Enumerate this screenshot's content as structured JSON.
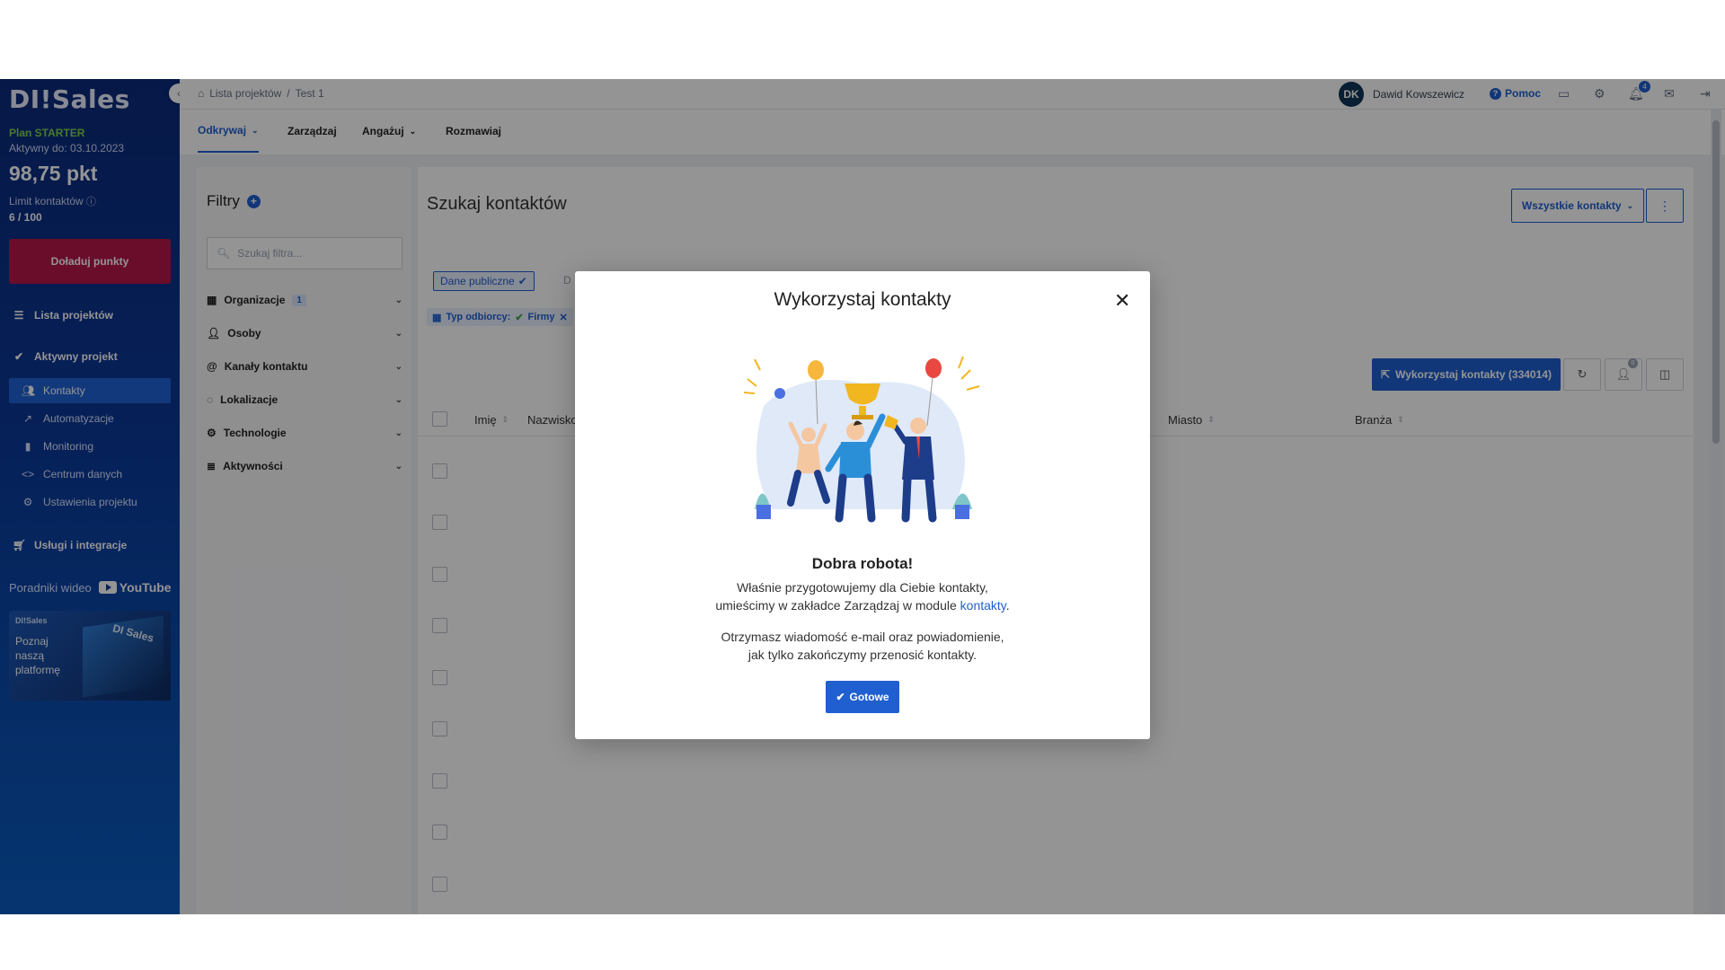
{
  "sidebar": {
    "logo": "DI!Sales",
    "plan": "Plan STARTER",
    "active_until": "Aktywny do: 03.10.2023",
    "points": "98,75 pkt",
    "limit_label": "Limit kontaktów",
    "limit_value": "6 / 100",
    "topup_label": "Doładuj punkty",
    "project_list": "Lista projektów",
    "active_project": "Aktywny projekt",
    "items": [
      {
        "label": "Kontakty",
        "icon": "people-icon"
      },
      {
        "label": "Automatyzacje",
        "icon": "trend-icon"
      },
      {
        "label": "Monitoring",
        "icon": "bar-chart-icon"
      },
      {
        "label": "Centrum danych",
        "icon": "code-icon"
      },
      {
        "label": "Ustawienia projektu",
        "icon": "gear-icon"
      }
    ],
    "services": "Usługi i integracje",
    "tutorials": "Poradniki wideo",
    "youtube": "YouTube",
    "promo_logo": "DI!Sales",
    "promo_text": "Poznaj naszą platformę",
    "promo_art_text": "DI Sales"
  },
  "topbar": {
    "breadcrumb": [
      "Lista projektów",
      "/",
      "Test 1"
    ],
    "avatar_initials": "DK",
    "user_name": "Dawid Kowszewicz",
    "help": "Pomoc",
    "notifications_count": "4"
  },
  "tabs": [
    "Odkrywaj",
    "Zarządzaj",
    "Angażuj",
    "Rozmawiaj"
  ],
  "filters": {
    "title": "Filtry",
    "search_placeholder": "Szukaj filtra...",
    "groups": [
      {
        "label": "Organizacje",
        "count": "1"
      },
      {
        "label": "Osoby"
      },
      {
        "label": "Kanały kontaktu"
      },
      {
        "label": "Lokalizacje"
      },
      {
        "label": "Technologie"
      },
      {
        "label": "Aktywności"
      }
    ]
  },
  "main": {
    "title": "Szukaj kontaktów",
    "all_contacts": "Wszystkie kontakty",
    "chip_public": "Dane publiczne",
    "chip_faded": "D",
    "recipient_chip_label": "Typ odbiorcy:",
    "recipient_chip_value": "Firmy",
    "use_contacts_label": "Wykorzystaj kontakty (334014)",
    "icon_badge": "0",
    "columns": [
      "Imię",
      "Nazwisko",
      "Miasto",
      "Branża"
    ]
  },
  "modal": {
    "title": "Wykorzystaj kontakty",
    "heading": "Dobra robota!",
    "line1": "Właśnie przygotowujemy dla Ciebie kontakty,",
    "line2_prefix": "umieścimy w zakładce Zarządzaj w module ",
    "line2_link": "kontakty",
    "line2_suffix": ".",
    "line3": "Otrzymasz wiadomość e-mail oraz powiadomienie,",
    "line4": "jak tylko zakończymy przenosić kontakty.",
    "done_label": "Gotowe"
  },
  "colors": {
    "accent": "#1f5fd0",
    "brand_red": "#b5174a",
    "plan_green": "#7fd24a"
  }
}
